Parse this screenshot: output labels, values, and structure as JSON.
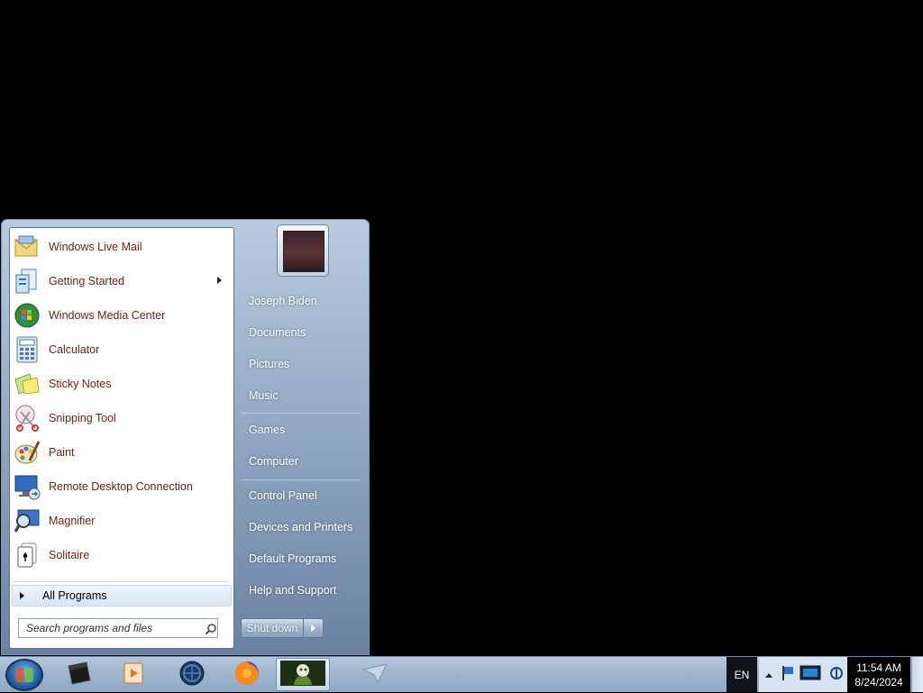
{
  "start_menu": {
    "pinned_programs": [
      {
        "label": "Windows Live Mail",
        "icon": "mail-icon",
        "has_submenu": false
      },
      {
        "label": "Getting Started",
        "icon": "getting-started-icon",
        "has_submenu": true
      },
      {
        "label": "Windows Media Center",
        "icon": "media-center-icon",
        "has_submenu": false
      },
      {
        "label": "Calculator",
        "icon": "calculator-icon",
        "has_submenu": false
      },
      {
        "label": "Sticky Notes",
        "icon": "sticky-notes-icon",
        "has_submenu": false
      },
      {
        "label": "Snipping Tool",
        "icon": "scissors-icon",
        "has_submenu": false
      },
      {
        "label": "Paint",
        "icon": "paint-palette-icon",
        "has_submenu": false
      },
      {
        "label": "Remote Desktop Connection",
        "icon": "remote-desktop-icon",
        "has_submenu": false
      },
      {
        "label": "Magnifier",
        "icon": "magnifier-icon",
        "has_submenu": false
      },
      {
        "label": "Solitaire",
        "icon": "playing-card-icon",
        "has_submenu": false
      }
    ],
    "all_programs_label": "All Programs",
    "search": {
      "placeholder": "Search programs and files",
      "value": ""
    },
    "places": [
      {
        "label": "Joseph Biden"
      },
      {
        "label": "Documents"
      },
      {
        "label": "Pictures"
      },
      {
        "label": "Music"
      },
      {
        "label": "Games"
      },
      {
        "label": "Computer"
      },
      {
        "label": "Control Panel"
      },
      {
        "label": "Devices and Printers"
      },
      {
        "label": "Default Programs"
      },
      {
        "label": "Help and Support"
      }
    ],
    "shutdown_label": "Shut down"
  },
  "taskbar": {
    "apps": [
      {
        "name": "black-window-app",
        "icon": "black-window-icon"
      },
      {
        "name": "media-player-app",
        "icon": "media-player-icon"
      },
      {
        "name": "globe-app",
        "icon": "globe-icon"
      },
      {
        "name": "firefox-app",
        "icon": "firefox-icon"
      },
      {
        "name": "image-viewer-app",
        "icon": "picture-thumbnail-icon",
        "active": true
      }
    ],
    "language": "EN",
    "clock_time": "11:54 AM",
    "clock_date": "8/24/2024"
  },
  "colors": {
    "program_text": "#7b1a10",
    "menu_glass": "#8ca3bf",
    "taskbar": "#9fb6cf"
  }
}
